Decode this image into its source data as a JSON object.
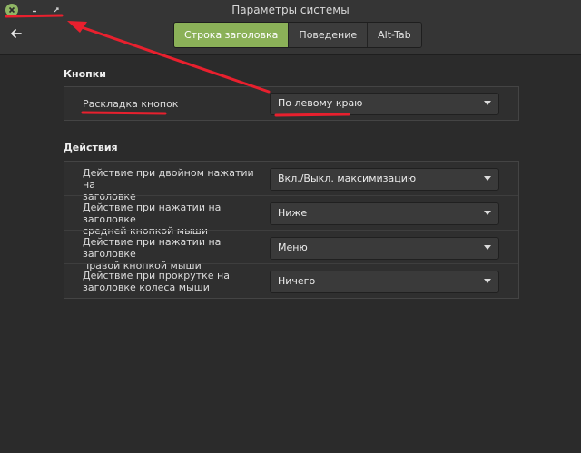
{
  "window": {
    "title": "Параметры системы"
  },
  "tabs": [
    {
      "label": "Строка заголовка",
      "active": true
    },
    {
      "label": "Поведение",
      "active": false
    },
    {
      "label": "Alt-Tab",
      "active": false
    }
  ],
  "buttons_section": {
    "title": "Кнопки",
    "layout_label": "Раскладка кнопок",
    "layout_value": "По левому краю"
  },
  "actions_section": {
    "title": "Действия",
    "rows": [
      {
        "label_line1": "Действие при двойном нажатии на",
        "label_line2": "заголовке",
        "value": "Вкл./Выкл. максимизацию"
      },
      {
        "label_line1": "Действие при нажатии на заголовке",
        "label_line2": "средней кнопкой мыши",
        "value": "Ниже"
      },
      {
        "label_line1": "Действие при нажатии на заголовке",
        "label_line2": "правой кнопкой мыши",
        "value": "Меню"
      },
      {
        "label_line1": "Действие при прокрутке на",
        "label_line2": "заголовке колеса мыши",
        "value": "Ничего"
      }
    ]
  },
  "icons": {
    "close": "close-icon",
    "minimize": "minimize-icon",
    "maximize": "maximize-icon",
    "back": "back-arrow-icon",
    "dropdown": "chevron-down-icon"
  },
  "colors": {
    "accent": "#8bb158",
    "annotation": "#e8202e",
    "background": "#2b2b2b"
  }
}
